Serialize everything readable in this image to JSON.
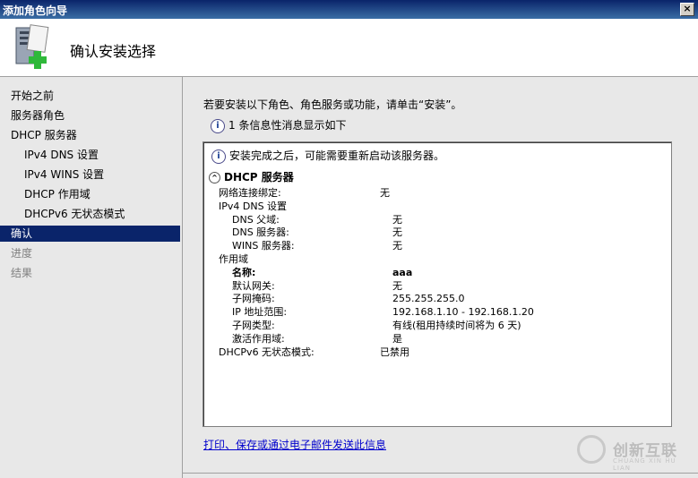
{
  "window": {
    "title": "添加角色向导",
    "close": "×"
  },
  "header": {
    "title": "确认安装选择"
  },
  "sidebar": {
    "items": [
      {
        "label": "开始之前",
        "sub": false,
        "state": "normal"
      },
      {
        "label": "服务器角色",
        "sub": false,
        "state": "normal"
      },
      {
        "label": "DHCP 服务器",
        "sub": false,
        "state": "normal"
      },
      {
        "label": "IPv4 DNS 设置",
        "sub": true,
        "state": "normal"
      },
      {
        "label": "IPv4 WINS 设置",
        "sub": true,
        "state": "normal"
      },
      {
        "label": "DHCP 作用域",
        "sub": true,
        "state": "normal"
      },
      {
        "label": "DHCPv6 无状态模式",
        "sub": true,
        "state": "normal"
      },
      {
        "label": "确认",
        "sub": false,
        "state": "active"
      },
      {
        "label": "进度",
        "sub": false,
        "state": "disabled"
      },
      {
        "label": "结果",
        "sub": false,
        "state": "disabled"
      }
    ]
  },
  "main": {
    "intro": "若要安装以下角色、角色服务或功能，请单击“安装”。",
    "info_count": "1 条信息性消息显示如下",
    "notice": "安装完成之后，可能需要重新启动该服务器。",
    "section_title": "DHCP 服务器",
    "rows": [
      {
        "key": "网络连接绑定:",
        "value": "无",
        "indent": 0,
        "bold": false
      },
      {
        "key": "IPv4 DNS 设置",
        "value": "",
        "indent": 0,
        "bold": false
      },
      {
        "key": "DNS 父域:",
        "value": "无",
        "indent": 1,
        "bold": false
      },
      {
        "key": "DNS 服务器:",
        "value": "无",
        "indent": 1,
        "bold": false
      },
      {
        "key": "WINS 服务器:",
        "value": "无",
        "indent": 1,
        "bold": false
      },
      {
        "key": "作用域",
        "value": "",
        "indent": 0,
        "bold": false
      },
      {
        "key": "名称:",
        "value": "aaa",
        "indent": 1,
        "bold": true
      },
      {
        "key": "默认网关:",
        "value": "无",
        "indent": 1,
        "bold": false
      },
      {
        "key": "子网掩码:",
        "value": "255.255.255.0",
        "indent": 1,
        "bold": false
      },
      {
        "key": "IP 地址范围:",
        "value": "192.168.1.10 - 192.168.1.20",
        "indent": 1,
        "bold": false
      },
      {
        "key": "子网类型:",
        "value": "有线(租用持续时间将为 6 天)",
        "indent": 1,
        "bold": false
      },
      {
        "key": "激活作用域:",
        "value": "是",
        "indent": 1,
        "bold": false
      },
      {
        "key": "DHCPv6 无状态模式:",
        "value": "已禁用",
        "indent": 0,
        "bold": false
      }
    ],
    "footer_link": "打印、保存或通过电子邮件发送此信息"
  },
  "watermark": {
    "text": "创新互联",
    "sub": "CHUANG XIN HU LIAN"
  },
  "colors": {
    "active_bg": "#0a246a",
    "link": "#0000cc",
    "titlebar": "#0a246a"
  },
  "icons": {
    "header": "server-add-icon",
    "info": "info-icon",
    "collapse": "chevron-up-icon"
  }
}
